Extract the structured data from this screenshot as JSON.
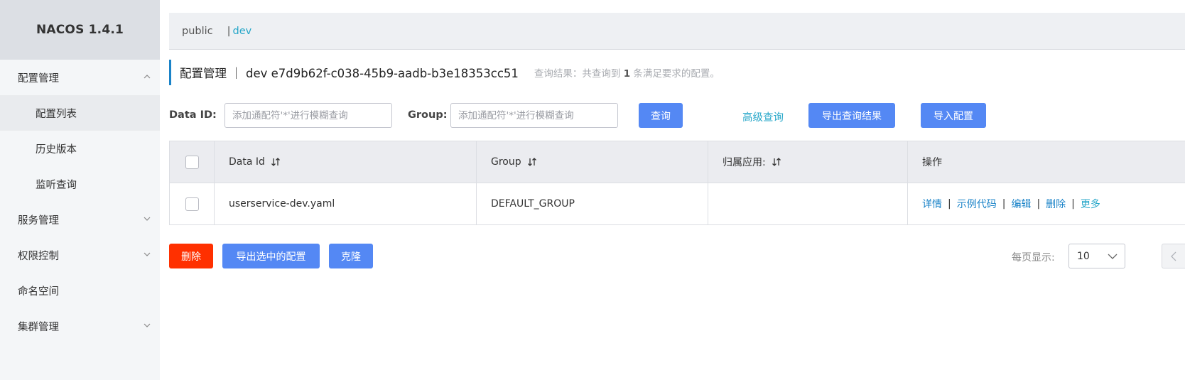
{
  "app": {
    "brand": "NACOS 1.4.1"
  },
  "sidebar": {
    "items": [
      {
        "label": "配置管理",
        "type": "group",
        "expanded": true
      },
      {
        "label": "配置列表",
        "type": "sub",
        "active": true
      },
      {
        "label": "历史版本",
        "type": "sub"
      },
      {
        "label": "监听查询",
        "type": "sub"
      },
      {
        "label": "服务管理",
        "type": "group",
        "expanded": false
      },
      {
        "label": "权限控制",
        "type": "group",
        "expanded": false
      },
      {
        "label": "命名空间",
        "type": "item"
      },
      {
        "label": "集群管理",
        "type": "group",
        "expanded": false
      }
    ]
  },
  "namespace_bar": {
    "public": "public",
    "separator": "|",
    "active": "dev"
  },
  "title": {
    "main": "配置管理 ｜ dev  e7d9b62f-c038-45b9-aadb-b3e18353cc51",
    "result_prefix": "查询结果：共查询到",
    "result_count": "1",
    "result_suffix": "条满足要求的配置。"
  },
  "search": {
    "data_id_label": "Data ID:",
    "data_id_placeholder": "添加通配符'*'进行模糊查询",
    "data_id_value": "",
    "group_label": "Group:",
    "group_placeholder": "添加通配符'*'进行模糊查询",
    "group_value": "",
    "query_button": "查询",
    "advanced_query": "高级查询",
    "export_results_button": "导出查询结果",
    "import_button": "导入配置"
  },
  "table": {
    "headers": [
      "Data Id",
      "Group",
      "归属应用:",
      "操作"
    ],
    "rows": [
      {
        "data_id": "userservice-dev.yaml",
        "group": "DEFAULT_GROUP",
        "app": "",
        "actions": [
          "详情",
          "示例代码",
          "编辑",
          "删除",
          "更多"
        ]
      }
    ]
  },
  "bottom": {
    "delete_button": "删除",
    "export_selected_button": "导出选中的配置",
    "clone_button": "克隆",
    "page_size_label": "每页显示:",
    "page_size_value": "10"
  },
  "colors": {
    "primary": "#5488f4",
    "danger": "#ff3000",
    "link": "#1a83c8",
    "accent_link": "#27a7c9",
    "sidebar_bg": "#f4f6f8",
    "brand_bg": "#dcdfe4"
  }
}
